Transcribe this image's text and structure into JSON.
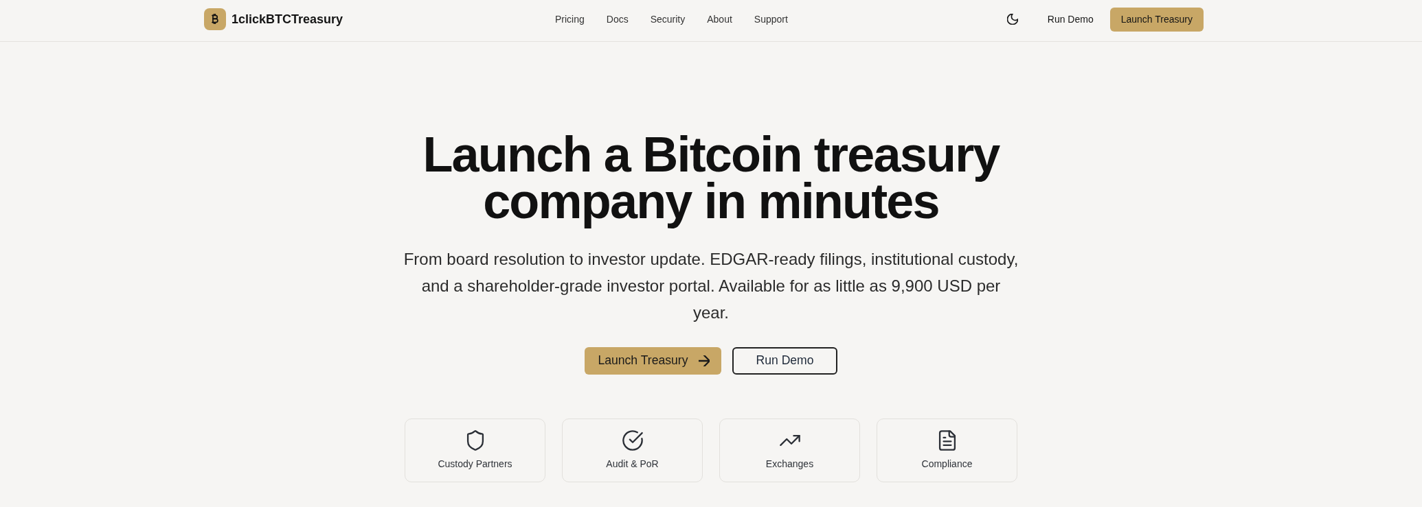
{
  "header": {
    "brand": "1clickBTCTreasury",
    "nav": [
      "Pricing",
      "Docs",
      "Security",
      "About",
      "Support"
    ],
    "actions": [
      {
        "label": "Run Demo",
        "kind": "ghost"
      },
      {
        "label": "Launch Treasury",
        "kind": "primary"
      }
    ]
  },
  "hero": {
    "title": "Launch a Bitcoin treasury company in minutes",
    "subtitle": "From board resolution to investor update. EDGAR-ready filings, institutional custody, and a shareholder-grade investor portal. Available for as little as 9,900 USD per year.",
    "buttons": [
      {
        "label": "Launch Treasury",
        "kind": "primary"
      },
      {
        "label": "Run Demo",
        "kind": "outline"
      }
    ]
  },
  "features": [
    "Custody Partners",
    "Audit & PoR",
    "Exchanges",
    "Compliance"
  ]
}
